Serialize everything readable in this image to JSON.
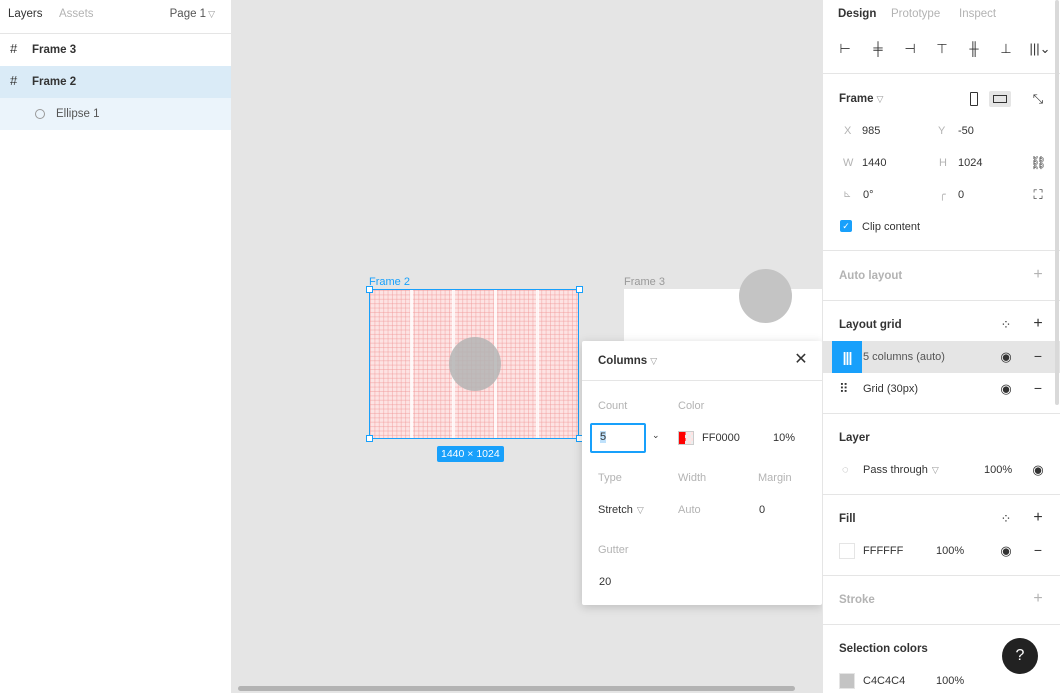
{
  "left_panel": {
    "tabs": [
      "Layers",
      "Assets"
    ],
    "page": "Page 1",
    "layers": [
      {
        "name": "Frame 3",
        "icon": "frame-icon"
      },
      {
        "name": "Frame 2",
        "icon": "frame-icon",
        "selected": true
      },
      {
        "name": "Ellipse 1",
        "icon": "ellipse-icon",
        "child": true
      }
    ]
  },
  "canvas": {
    "frame2_label": "Frame 2",
    "frame3_label": "Frame 3",
    "size_badge": "1440 × 1024"
  },
  "popover": {
    "title": "Columns",
    "count_label": "Count",
    "count_value": "5",
    "color_label": "Color",
    "color_hex": "FF0000",
    "color_opacity": "10%",
    "type_label": "Type",
    "type_value": "Stretch",
    "width_label": "Width",
    "width_value": "Auto",
    "margin_label": "Margin",
    "margin_value": "0",
    "gutter_label": "Gutter",
    "gutter_value": "20"
  },
  "right_panel": {
    "tabs": [
      "Design",
      "Prototype",
      "Inspect"
    ],
    "frame": {
      "title": "Frame",
      "x_label": "X",
      "x": "985",
      "y_label": "Y",
      "y": "-50",
      "w_label": "W",
      "w": "1440",
      "h_label": "H",
      "h": "1024",
      "rotation": "0°",
      "radius": "0",
      "clip_content": "Clip content"
    },
    "auto_layout": "Auto layout",
    "layout_grid": {
      "title": "Layout grid",
      "items": [
        "5 columns (auto)",
        "Grid (30px)"
      ]
    },
    "layer": {
      "title": "Layer",
      "blend": "Pass through",
      "opacity": "100%"
    },
    "fill": {
      "title": "Fill",
      "hex": "FFFFFF",
      "opacity": "100%"
    },
    "stroke": "Stroke",
    "selection_colors": {
      "title": "Selection colors",
      "hex": "C4C4C4",
      "opacity": "100%"
    }
  },
  "help": "?",
  "colors": {
    "accent": "#18a0fb",
    "grid_red": "#ff0000",
    "selection": "#c4c4c4"
  }
}
